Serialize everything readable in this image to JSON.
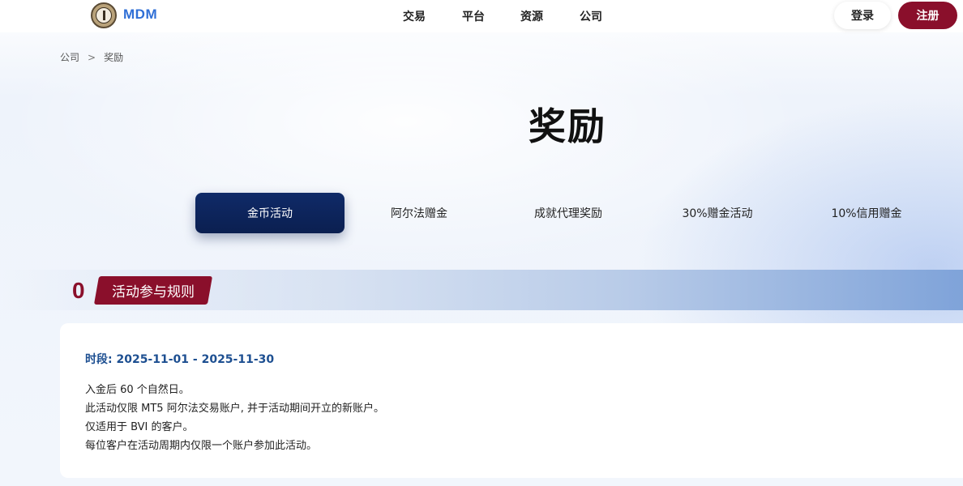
{
  "header": {
    "brand": "MDM",
    "nav": [
      "交易",
      "平台",
      "资源",
      "公司"
    ],
    "login": "登录",
    "register": "注册"
  },
  "breadcrumb": {
    "parent": "公司",
    "separator": ">",
    "current": "奖励"
  },
  "page_title": "奖励",
  "tabs": [
    {
      "label": "金币活动",
      "active": true
    },
    {
      "label": "阿尔法赠金",
      "active": false
    },
    {
      "label": "成就代理奖励",
      "active": false
    },
    {
      "label": "30%赠金活动",
      "active": false
    },
    {
      "label": "10%信用赠金",
      "active": false
    }
  ],
  "section": {
    "number": "0",
    "title": "活动参与规则"
  },
  "card": {
    "period": "时段: 2025-11-01 - 2025-11-30",
    "rules": [
      "入金后 60 个自然日。",
      "此活动仅限 MT5 阿尔法交易账户, 并于活动期间开立的新账户。",
      "仅适用于 BVI 的客户。",
      "每位客户在活动周期内仅限一个账户参加此活动。"
    ]
  },
  "colors": {
    "brand_blue": "#2f6fd6",
    "accent_red": "#8a0f2b",
    "tab_active_bg": "#0f2a68",
    "period_text": "#1d4f91"
  }
}
